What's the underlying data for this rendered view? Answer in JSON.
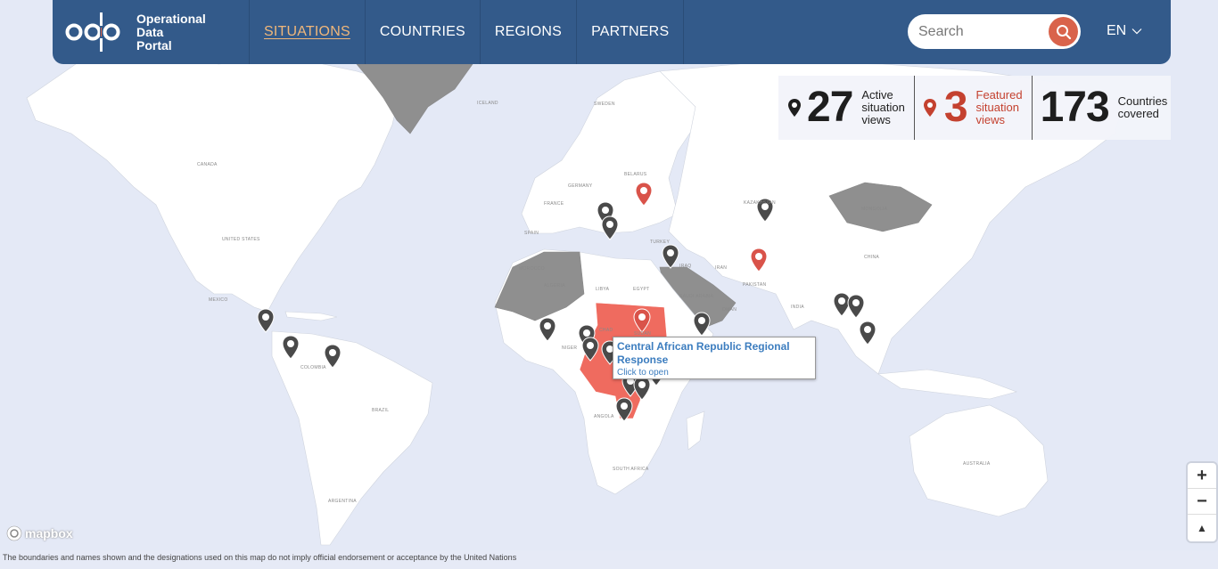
{
  "header": {
    "logo_lines": [
      "Operational",
      "Data",
      "Portal"
    ],
    "nav": [
      {
        "label": "SITUATIONS",
        "active": true
      },
      {
        "label": "COUNTRIES",
        "active": false
      },
      {
        "label": "REGIONS",
        "active": false
      },
      {
        "label": "PARTNERS",
        "active": false
      }
    ],
    "search_placeholder": "Search",
    "language": "EN"
  },
  "stats": {
    "active": {
      "value": "27",
      "label_lines": [
        "Active",
        "situation",
        "views"
      ]
    },
    "featured": {
      "value": "3",
      "label_lines": [
        "Featured",
        "situation",
        "views"
      ]
    },
    "countries": {
      "value": "173",
      "label_lines": [
        "Countries",
        "covered"
      ]
    }
  },
  "popup": {
    "title": "Central African Republic Regional Response",
    "subtitle": "Click to open"
  },
  "map_labels": {
    "canada": "CANADA",
    "united_states": "UNITED STATES",
    "mexico": "MEXICO",
    "brazil": "BRAZIL",
    "argentina": "ARGENTINA",
    "colombia": "COLOMBIA",
    "iceland": "ICELAND",
    "sweden": "SWEDEN",
    "germany": "GERMANY",
    "france": "FRANCE",
    "spain": "SPAIN",
    "belarus": "BELARUS",
    "turkey": "TURKEY",
    "iraq": "IRAQ",
    "iran": "IRAN",
    "kazakhstan": "KAZAKHSTAN",
    "mongolia": "MONGOLIA",
    "china": "CHINA",
    "india": "INDIA",
    "pakistan": "PAKISTAN",
    "morocco": "MOROCCO",
    "algeria": "ALGERIA",
    "libya": "LIBYA",
    "egypt": "EGYPT",
    "saudi_arabia": "SAUDI ARABIA",
    "oman": "OMAN",
    "sudan": "SUDAN",
    "chad": "CHAD",
    "niger": "NIGER",
    "angola": "ANGOLA",
    "south_africa": "SOUTH AFRICA",
    "australia": "AUSTRALIA"
  },
  "colors": {
    "header_bg": "#335a8a",
    "nav_active": "#f0b77a",
    "featured": "#c4412f",
    "highlight_region": "#ef6b5f",
    "shaded_country": "#8f8f8f",
    "ocean": "#e4e9f6",
    "land": "#ffffff"
  },
  "zoom_controls": {
    "zoom_in": "+",
    "zoom_out": "−",
    "compass": "▲"
  },
  "mapbox_attribution": "mapbox",
  "disclaimer": "The boundaries and names shown and the designations used on this map do not imply official endorsement or acceptance by the United Nations"
}
